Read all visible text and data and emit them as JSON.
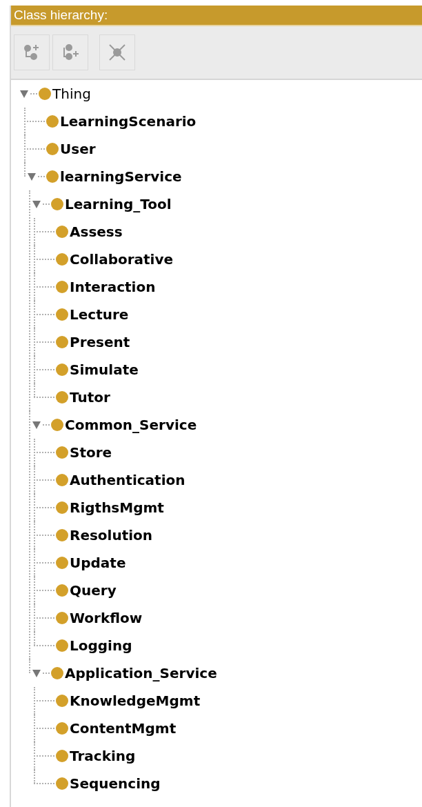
{
  "panel": {
    "title": "Class hierarchy:"
  },
  "toolbar": [
    {
      "kind": "add-child"
    },
    {
      "kind": "add-sibling"
    },
    {
      "kind": "delete"
    }
  ],
  "tree": [
    {
      "label": "Thing",
      "bold": false,
      "expanded": true,
      "children": [
        {
          "label": "LearningScenario",
          "bold": true
        },
        {
          "label": "User",
          "bold": true
        },
        {
          "label": "learningService",
          "bold": true,
          "expanded": true,
          "children": [
            {
              "label": "Learning_Tool",
              "bold": true,
              "expanded": true,
              "children": [
                {
                  "label": "Assess",
                  "bold": true
                },
                {
                  "label": "Collaborative",
                  "bold": true
                },
                {
                  "label": "Interaction",
                  "bold": true
                },
                {
                  "label": "Lecture",
                  "bold": true
                },
                {
                  "label": "Present",
                  "bold": true
                },
                {
                  "label": "Simulate",
                  "bold": true
                },
                {
                  "label": "Tutor",
                  "bold": true
                }
              ]
            },
            {
              "label": "Common_Service",
              "bold": true,
              "expanded": true,
              "children": [
                {
                  "label": "Store",
                  "bold": true
                },
                {
                  "label": "Authentication",
                  "bold": true
                },
                {
                  "label": "RigthsMgmt",
                  "bold": true
                },
                {
                  "label": "Resolution",
                  "bold": true
                },
                {
                  "label": "Update",
                  "bold": true
                },
                {
                  "label": "Query",
                  "bold": true
                },
                {
                  "label": "Workflow",
                  "bold": true
                },
                {
                  "label": "Logging",
                  "bold": true
                }
              ]
            },
            {
              "label": "Application_Service",
              "bold": true,
              "expanded": true,
              "children": [
                {
                  "label": "KnowledgeMgmt",
                  "bold": true
                },
                {
                  "label": "ContentMgmt",
                  "bold": true
                },
                {
                  "label": "Tracking",
                  "bold": true
                },
                {
                  "label": "Sequencing",
                  "bold": true
                }
              ]
            }
          ]
        }
      ]
    }
  ]
}
